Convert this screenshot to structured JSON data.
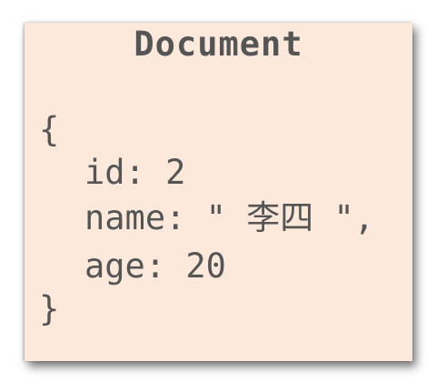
{
  "document": {
    "title": "Document",
    "lines": [
      "{",
      "id: 2",
      "name: \" 李四 \",",
      "age: 20",
      "}"
    ]
  }
}
